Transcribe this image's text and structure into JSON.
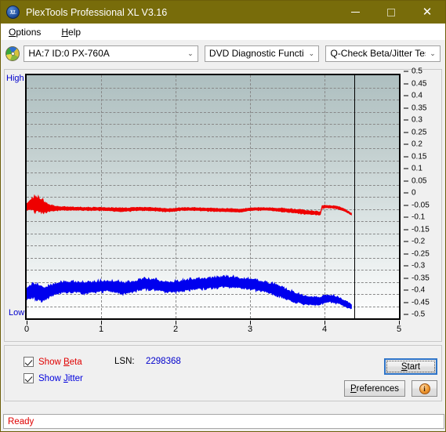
{
  "window": {
    "title": "PlexTools Professional XL V3.16",
    "app_icon": "xl-disc-icon",
    "icon_text": "XL",
    "titlebar_color": "#786c0a",
    "minimize_label": "–",
    "maximize_label": "□",
    "close_label": "✕"
  },
  "menubar": {
    "items": [
      {
        "label": "Options",
        "accel": "O"
      },
      {
        "label": "Help",
        "accel": "H"
      }
    ]
  },
  "toolbar": {
    "drive_icon": "cd-disc-icon",
    "drive_select": {
      "value": "HA:7 ID:0  PX-760A",
      "caret": "⌄"
    },
    "function_select": {
      "value": "DVD Diagnostic Functions",
      "caret": "⌄"
    },
    "test_select": {
      "value": "Q-Check Beta/Jitter Test",
      "caret": "⌄"
    }
  },
  "chart_labels": {
    "high": "High",
    "low": "Low"
  },
  "controls": {
    "show_beta": {
      "label_pre": "Show ",
      "label_accel": "B",
      "label_post": "eta",
      "checked": true,
      "color": "#e00000"
    },
    "show_jitter": {
      "label_pre": "Show ",
      "label_accel": "J",
      "label_post": "itter",
      "checked": true,
      "color": "#0000dd"
    },
    "lsn_label": "LSN:",
    "lsn_value": "2298368",
    "start_button": {
      "pre": "",
      "accel": "S",
      "post": "tart",
      "focused": true
    },
    "preferences_button": {
      "pre": "",
      "accel": "P",
      "post": "references"
    },
    "info_button": {
      "icon": "info-icon",
      "glyph": "i"
    }
  },
  "statusbar": {
    "text": "Ready",
    "color": "#e00000"
  },
  "chart_data": {
    "type": "line",
    "title": "Q-Check Beta/Jitter Test",
    "xlabel": "",
    "ylabel": "",
    "xlim": [
      0,
      5
    ],
    "ylim": [
      -0.5,
      0.5
    ],
    "xticks": [
      0,
      1,
      2,
      3,
      4,
      5
    ],
    "yticks": [
      0.5,
      0.45,
      0.4,
      0.35,
      0.3,
      0.25,
      0.2,
      0.15,
      0.1,
      0.05,
      0,
      -0.05,
      -0.1,
      -0.15,
      -0.2,
      -0.25,
      -0.3,
      -0.35,
      -0.4,
      -0.45,
      -0.5
    ],
    "grid": true,
    "grid_style": "dashed",
    "legend": [
      "Show Beta",
      "Show Jitter"
    ],
    "data_end_x": 4.4,
    "plot_bg_gradient": [
      "#aebfc0",
      "#ffffff"
    ],
    "annotations": [
      {
        "type": "vline",
        "x": 4.4,
        "color": "#000000",
        "label": "end-of-data marker"
      }
    ],
    "series": [
      {
        "name": "Beta",
        "color": "#ee0000",
        "band": true,
        "x": [
          0.0,
          0.05,
          0.1,
          0.15,
          0.2,
          0.25,
          0.3,
          0.4,
          0.5,
          0.6,
          0.7,
          0.8,
          0.9,
          1.0,
          1.1,
          1.2,
          1.3,
          1.4,
          1.5,
          1.6,
          1.7,
          1.8,
          1.9,
          2.0,
          2.1,
          2.2,
          2.3,
          2.4,
          2.5,
          2.6,
          2.7,
          2.8,
          2.9,
          3.0,
          3.1,
          3.2,
          3.3,
          3.4,
          3.5,
          3.6,
          3.7,
          3.8,
          3.9,
          3.98,
          4.0,
          4.05,
          4.1,
          4.15,
          4.2,
          4.25,
          4.3,
          4.35,
          4.4
        ],
        "mean": [
          -0.04,
          -0.032,
          -0.028,
          -0.03,
          -0.036,
          -0.042,
          -0.046,
          -0.048,
          -0.048,
          -0.049,
          -0.049,
          -0.05,
          -0.05,
          -0.05,
          -0.051,
          -0.052,
          -0.053,
          -0.052,
          -0.05,
          -0.05,
          -0.051,
          -0.053,
          -0.055,
          -0.054,
          -0.05,
          -0.05,
          -0.051,
          -0.052,
          -0.053,
          -0.054,
          -0.055,
          -0.056,
          -0.057,
          -0.052,
          -0.05,
          -0.05,
          -0.051,
          -0.053,
          -0.055,
          -0.058,
          -0.061,
          -0.064,
          -0.066,
          -0.068,
          -0.042,
          -0.04,
          -0.041,
          -0.042,
          -0.044,
          -0.048,
          -0.054,
          -0.062,
          -0.072
        ],
        "spread": [
          0.018,
          0.03,
          0.04,
          0.044,
          0.04,
          0.03,
          0.02,
          0.012,
          0.01,
          0.009,
          0.009,
          0.009,
          0.009,
          0.009,
          0.009,
          0.01,
          0.01,
          0.01,
          0.009,
          0.009,
          0.009,
          0.009,
          0.009,
          0.009,
          0.008,
          0.008,
          0.008,
          0.008,
          0.009,
          0.009,
          0.009,
          0.009,
          0.009,
          0.008,
          0.008,
          0.008,
          0.008,
          0.009,
          0.01,
          0.01,
          0.011,
          0.011,
          0.01,
          0.009,
          0.008,
          0.007,
          0.007,
          0.007,
          0.007,
          0.007,
          0.007,
          0.006,
          0.006
        ]
      },
      {
        "name": "Jitter",
        "color": "#0000ee",
        "band": true,
        "x": [
          0.0,
          0.05,
          0.1,
          0.15,
          0.2,
          0.25,
          0.3,
          0.4,
          0.5,
          0.6,
          0.7,
          0.8,
          0.9,
          1.0,
          1.1,
          1.2,
          1.3,
          1.4,
          1.5,
          1.6,
          1.7,
          1.8,
          1.9,
          2.0,
          2.1,
          2.2,
          2.3,
          2.4,
          2.5,
          2.6,
          2.7,
          2.8,
          2.9,
          3.0,
          3.1,
          3.2,
          3.3,
          3.4,
          3.5,
          3.6,
          3.7,
          3.8,
          3.9,
          3.98,
          4.0,
          4.05,
          4.1,
          4.15,
          4.2,
          4.25,
          4.3,
          4.35,
          4.4
        ],
        "mean": [
          -0.4,
          -0.39,
          -0.385,
          -0.392,
          -0.4,
          -0.398,
          -0.39,
          -0.378,
          -0.372,
          -0.37,
          -0.372,
          -0.374,
          -0.372,
          -0.368,
          -0.366,
          -0.37,
          -0.376,
          -0.372,
          -0.364,
          -0.358,
          -0.36,
          -0.366,
          -0.372,
          -0.37,
          -0.366,
          -0.362,
          -0.358,
          -0.356,
          -0.354,
          -0.352,
          -0.35,
          -0.352,
          -0.356,
          -0.358,
          -0.362,
          -0.368,
          -0.376,
          -0.386,
          -0.398,
          -0.41,
          -0.42,
          -0.426,
          -0.428,
          -0.43,
          -0.424,
          -0.42,
          -0.418,
          -0.42,
          -0.424,
          -0.43,
          -0.438,
          -0.446,
          -0.452
        ],
        "spread": [
          0.035,
          0.04,
          0.042,
          0.044,
          0.042,
          0.038,
          0.034,
          0.03,
          0.03,
          0.03,
          0.032,
          0.032,
          0.032,
          0.03,
          0.03,
          0.032,
          0.034,
          0.032,
          0.03,
          0.03,
          0.03,
          0.03,
          0.032,
          0.03,
          0.03,
          0.03,
          0.03,
          0.03,
          0.03,
          0.03,
          0.03,
          0.03,
          0.03,
          0.03,
          0.03,
          0.03,
          0.03,
          0.03,
          0.03,
          0.028,
          0.026,
          0.024,
          0.022,
          0.022,
          0.022,
          0.022,
          0.02,
          0.02,
          0.02,
          0.018,
          0.018,
          0.016,
          0.014
        ]
      }
    ]
  }
}
